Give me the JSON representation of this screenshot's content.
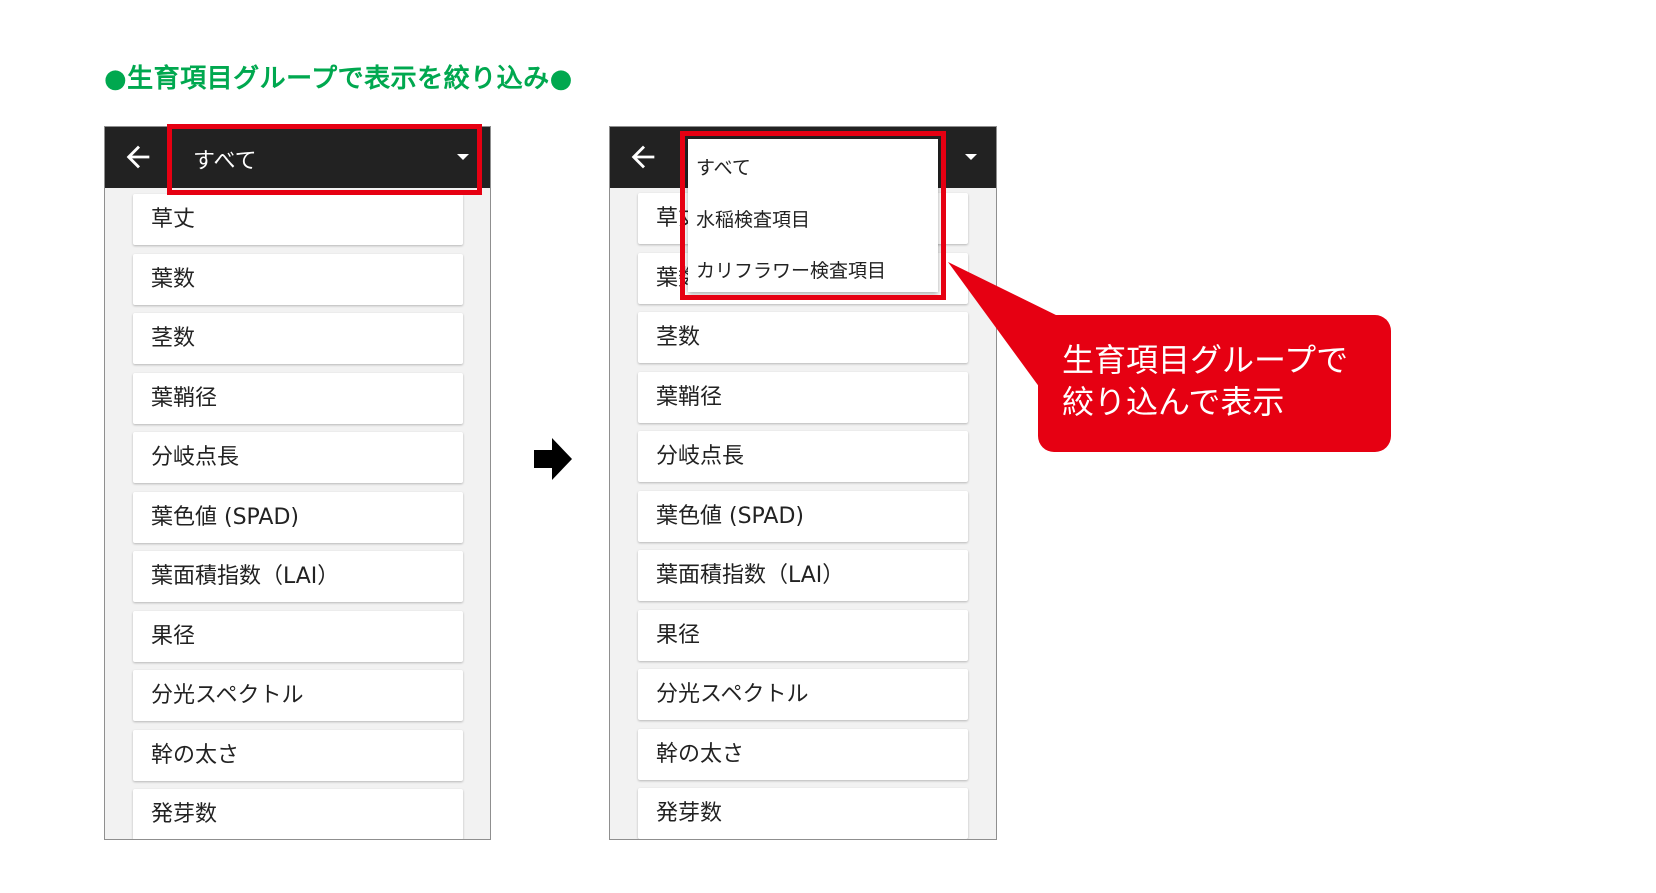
{
  "heading": "●生育項目グループで表示を絞り込み●",
  "before": {
    "selected_group": "すべて",
    "items": [
      "草丈",
      "葉数",
      "茎数",
      "葉鞘径",
      "分岐点長",
      "葉色値 (SPAD)",
      "葉面積指数（LAI）",
      "果径",
      "分光スペクトル",
      "幹の太さ",
      "発芽数"
    ]
  },
  "after": {
    "dropdown_options": [
      "すべて",
      "水稲検査項目",
      "カリフラワー検査項目"
    ],
    "items": [
      "草丈",
      "葉数",
      "茎数",
      "葉鞘径",
      "分岐点長",
      "葉色値 (SPAD)",
      "葉面積指数（LAI）",
      "果径",
      "分光スペクトル",
      "幹の太さ",
      "発芽数"
    ]
  },
  "callout": {
    "line1": "生育項目グループで",
    "line2": "絞り込んで表示"
  },
  "colors": {
    "highlight": "#e60012",
    "heading": "#00a84f",
    "appbar": "#222222",
    "callout": "#e60012"
  },
  "icons": {
    "back": "back-arrow-icon",
    "dropdown": "caret-down-icon",
    "transition": "right-arrow-icon"
  }
}
